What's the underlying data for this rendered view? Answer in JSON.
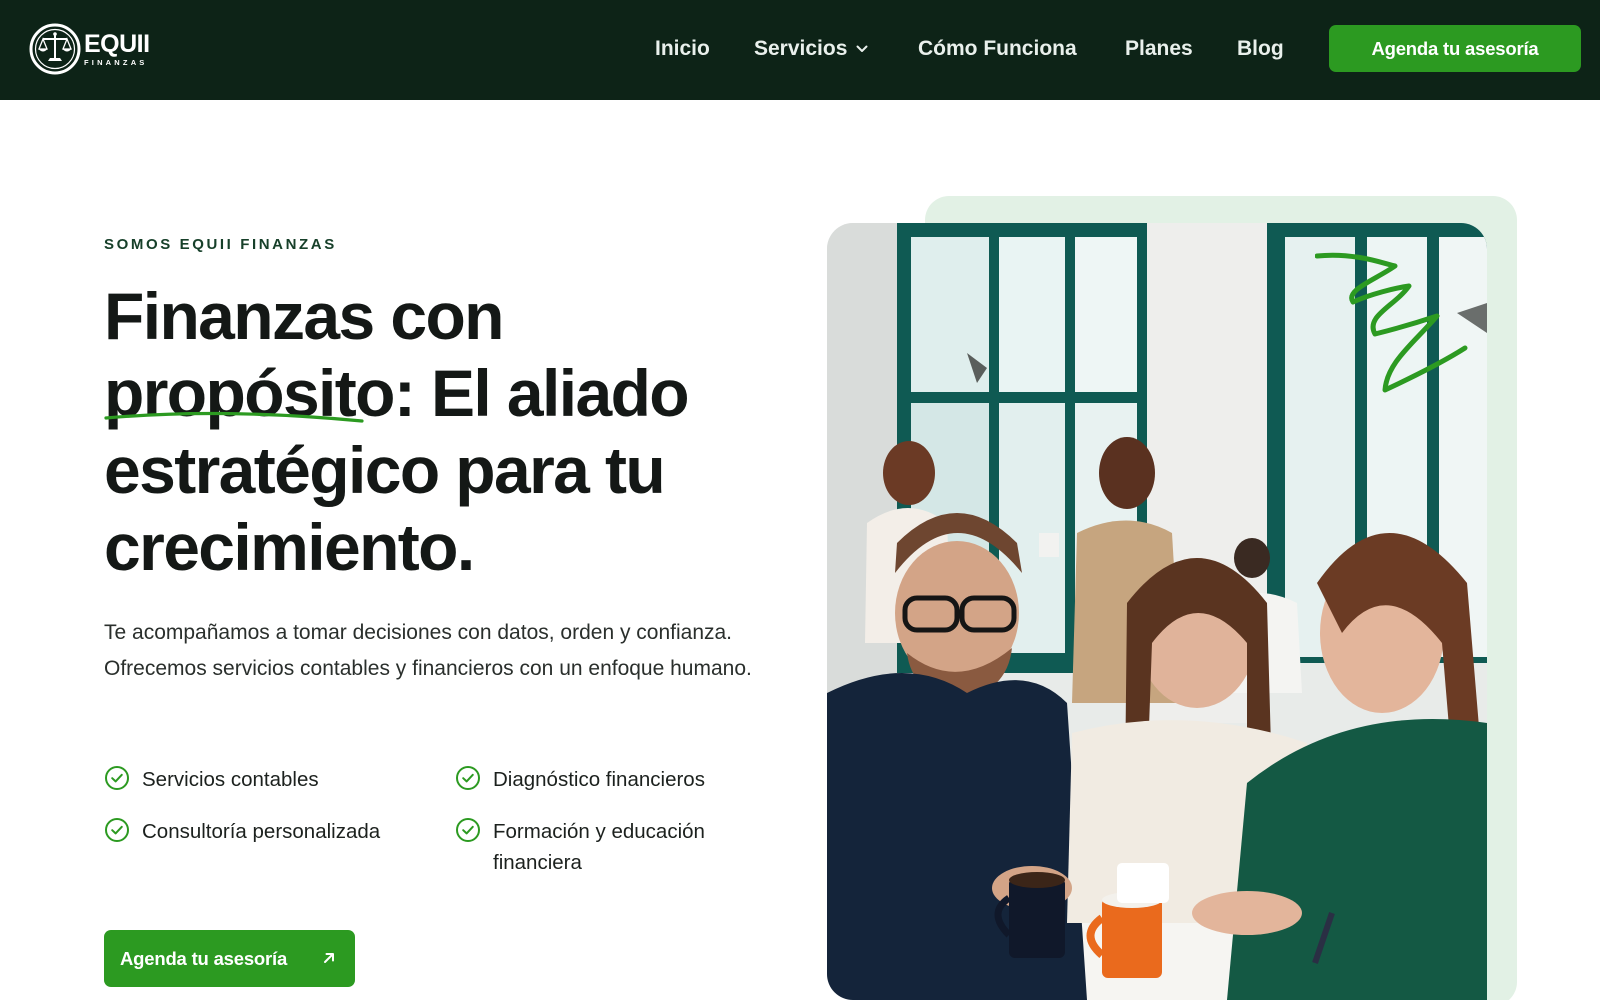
{
  "brand": {
    "name": "EQUII",
    "subtitle": "FINANZAS",
    "logo_icon": "scale-of-justice-icon"
  },
  "nav": {
    "links": [
      {
        "label": "Inicio"
      },
      {
        "label": "Servicios",
        "has_dropdown": true,
        "icon": "chevron-down-icon"
      },
      {
        "label": "Cómo Funciona"
      },
      {
        "label": "Planes"
      },
      {
        "label": "Blog"
      }
    ],
    "cta_label": "Agenda tu asesoría"
  },
  "hero": {
    "eyebrow": "SOMOS EQUII FINANZAS",
    "title_parts": {
      "line1": "Finanzas con",
      "highlight": "propósito",
      "line2_rest": ": El aliado",
      "line3": "estratégico para tu",
      "line4": "crecimiento."
    },
    "description": "Te acompañamos a tomar decisiones con datos, orden y confianza. Ofrecemos servicios contables y financieros con un enfoque humano.",
    "features": [
      {
        "label": "Servicios contables",
        "icon": "check-circle-icon"
      },
      {
        "label": "Diagnóstico financieros",
        "icon": "check-circle-icon"
      },
      {
        "label": "Consultoría personalizada",
        "icon": "check-circle-icon"
      },
      {
        "label": "Formación y educación financiera",
        "icon": "check-circle-icon"
      }
    ],
    "cta_label": "Agenda tu asesoría",
    "cta_icon": "arrow-up-right-icon"
  },
  "colors": {
    "nav_bg": "#0d2317",
    "accent_green": "#2c9a21",
    "panel_mint": "#e2f1e5",
    "heading": "#141816"
  }
}
